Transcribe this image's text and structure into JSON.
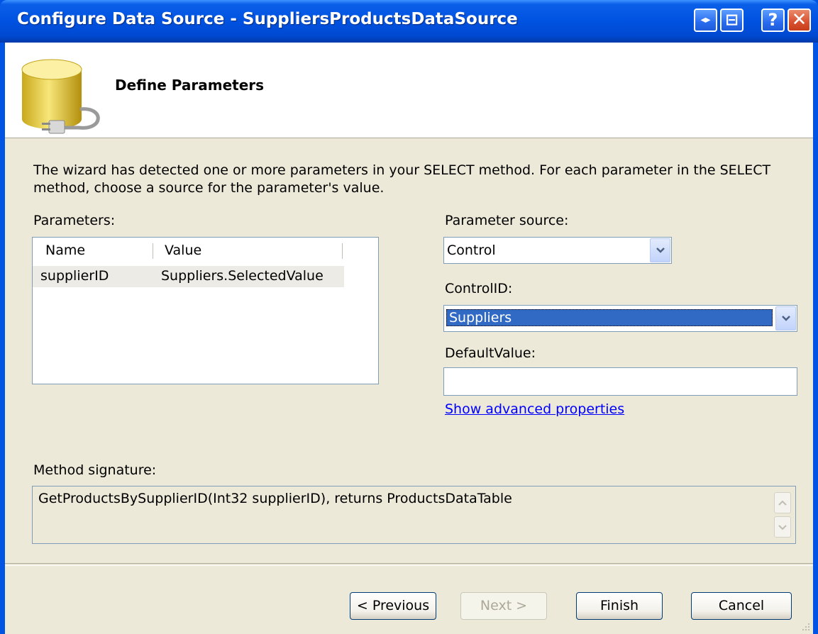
{
  "window": {
    "title": "Configure Data Source - SuppliersProductsDataSource",
    "controls": {
      "menu_glyph": "◂▸",
      "minimize_glyph": "⊟",
      "help_glyph": "?",
      "close_glyph": "✕"
    }
  },
  "header": {
    "title": "Define Parameters",
    "icon": "database-plug-icon"
  },
  "intro_text": "The wizard has detected one or more parameters in your SELECT method. For each parameter in the SELECT method, choose a source for the parameter's value.",
  "parameters": {
    "label": "Parameters:",
    "columns": [
      "Name",
      "Value"
    ],
    "rows": [
      {
        "name": "supplierID",
        "value": "Suppliers.SelectedValue"
      }
    ]
  },
  "parameter_source": {
    "label": "Parameter source:",
    "value": "Control"
  },
  "control_id": {
    "label": "ControlID:",
    "value": "Suppliers"
  },
  "default_value": {
    "label": "DefaultValue:",
    "value": ""
  },
  "advanced_link": "Show advanced properties",
  "method_signature": {
    "label": "Method signature:",
    "value": "GetProductsBySupplierID(Int32 supplierID), returns ProductsDataTable"
  },
  "buttons": {
    "previous": "< Previous",
    "next": "Next >",
    "finish": "Finish",
    "cancel": "Cancel"
  },
  "colors": {
    "titlebar": "#0054e3",
    "selection": "#316ac5",
    "dialog_bg": "#ece9d8",
    "link": "#0000ff"
  }
}
